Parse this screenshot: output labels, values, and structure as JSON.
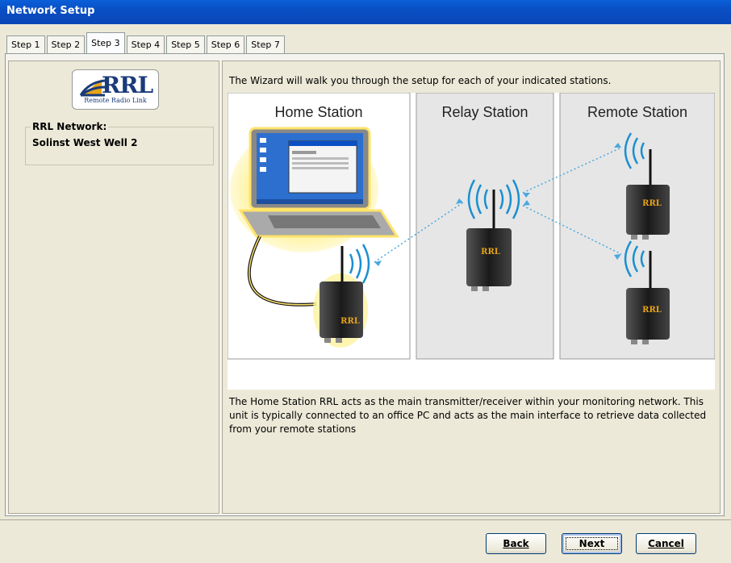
{
  "window": {
    "title": "Network Setup"
  },
  "tabs": [
    "Step 1",
    "Step 2",
    "Step 3",
    "Step 4",
    "Step 5",
    "Step 6",
    "Step 7"
  ],
  "active_tab_index": 2,
  "left_panel": {
    "logo_text": "RRL",
    "logo_subtitle": "Remote Radio Link",
    "group_label": "RRL Network:",
    "network_name": "Solinst West Well 2"
  },
  "main": {
    "intro_text": "The Wizard will walk you through the setup for each of your indicated stations.",
    "illustration": {
      "home_station_label": "Home Station",
      "relay_station_label": "Relay Station",
      "remote_station_label": "Remote Station",
      "device_logo": "RRL"
    },
    "description": "The Home Station RRL acts as the main transmitter/receiver within your monitoring network. This unit is typically connected to an office PC and acts as the main interface to retrieve data collected from your remote stations"
  },
  "buttons": {
    "back": "Back",
    "next": "Next",
    "cancel": "Cancel"
  },
  "colors": {
    "title_bar": "#0a4fc4",
    "signal": "#1a8fd0",
    "panel_bg": "#ece9d8"
  }
}
